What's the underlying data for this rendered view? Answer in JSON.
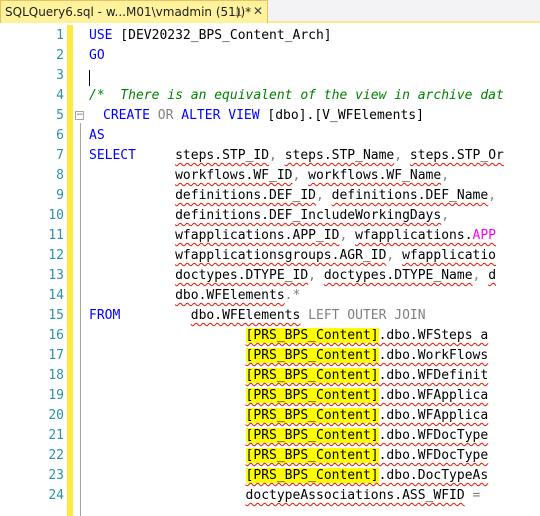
{
  "tab": {
    "title": "SQLQuery6.sql - w...M01\\vmadmin (51))*",
    "pin_icon": "pin-icon",
    "close_icon": "close-icon"
  },
  "colors": {
    "keyword": "#0000ff",
    "comment": "#008000",
    "line_number": "#2b91af",
    "gray_operator": "#808080",
    "function": "#ff00ff",
    "highlight": "#ffff00",
    "change_bar": "#ffeb3b",
    "tab_active": "#fff29d"
  },
  "line_numbers": [
    "1",
    "2",
    "3",
    "4",
    "5",
    "6",
    "7",
    "8",
    "9",
    "10",
    "11",
    "12",
    "13",
    "14",
    "15",
    "16",
    "17",
    "18",
    "19",
    "20",
    "21",
    "22",
    "23",
    "24"
  ],
  "code": {
    "l1": {
      "kw": "USE",
      "text": " [DEV20232_BPS_Content_Arch]"
    },
    "l2": {
      "kw": "GO"
    },
    "l4": {
      "comment": "/*  There is an equivalent of the view in archive dat"
    },
    "l5": {
      "kw1": "CREATE",
      "sp1": " ",
      "gray": "OR",
      "sp2": " ",
      "kw2": "ALTER",
      "sp3": " ",
      "kw3": "VIEW",
      "text": " [dbo].[V_WFElements]"
    },
    "l6": {
      "kw": "AS"
    },
    "l7": {
      "kw": "SELECT",
      "gap": "     ",
      "t1": "steps.STP_ID",
      "c1": ", ",
      "t2": "steps.STP_Name",
      "c2": ", ",
      "t3": "steps.STP_Or"
    },
    "l8": {
      "indent": "           ",
      "t1": "workflows.WF_ID",
      "c1": ", ",
      "t2": "workflows.WF_Name",
      "c2": ","
    },
    "l9": {
      "indent": "           ",
      "t1": "definitions.DEF_ID",
      "c1": ", ",
      "t2": "definitions.DEF_Name",
      "c2": ", "
    },
    "l10": {
      "indent": "           ",
      "t1": "definitions.DEF_IncludeWorkingDays",
      "c1": ","
    },
    "l11": {
      "indent": "           ",
      "t1": "wfapplications.APP_ID",
      "c1": ", ",
      "t2": "wfapplications.",
      "fn": "APP"
    },
    "l12": {
      "indent": "           ",
      "t1": "wfapplicationsgroups.AGR_ID",
      "c1": ", ",
      "t2": "wfapplicatio"
    },
    "l13": {
      "indent": "           ",
      "t1": "doctypes.DTYPE_ID",
      "c1": ", ",
      "t2": "doctypes.DTYPE_Name",
      "c2": ", ",
      "t3": "d"
    },
    "l14": {
      "indent": "           ",
      "t1": "dbo.WFElements",
      "star": ".*"
    },
    "l15": {
      "kw": "FROM",
      "gap": "         ",
      "t1": "dbo.WFElements",
      "join": " LEFT OUTER JOIN"
    },
    "l16": {
      "indent": "                    ",
      "db": "[PRS_BPS_Content]",
      "rest": ".dbo.WFSteps a"
    },
    "l17": {
      "indent": "                    ",
      "db": "[PRS_BPS_Content]",
      "rest": ".dbo.WorkFlows"
    },
    "l18": {
      "indent": "                    ",
      "db": "[PRS_BPS_Content]",
      "rest": ".dbo.WFDefinit"
    },
    "l19": {
      "indent": "                    ",
      "db": "[PRS_BPS_Content]",
      "rest": ".dbo.WFApplica"
    },
    "l20": {
      "indent": "                    ",
      "db": "[PRS_BPS_Content]",
      "rest": ".dbo.WFApplica"
    },
    "l21": {
      "indent": "                    ",
      "db": "[PRS_BPS_Content]",
      "rest": ".dbo.WFDocType"
    },
    "l22": {
      "indent": "                    ",
      "db": "[PRS_BPS_Content]",
      "rest": ".dbo.WFDocType"
    },
    "l23": {
      "indent": "                    ",
      "db": "[PRS_BPS_Content]",
      "rest": ".dbo.DocTypeAs"
    },
    "l24": {
      "indent": "                    ",
      "t1": "doctypeAssociations.ASS_WFID",
      "rest": " ="
    }
  }
}
